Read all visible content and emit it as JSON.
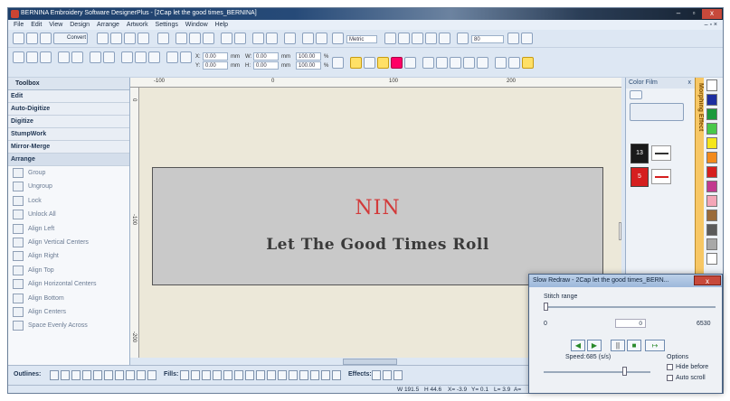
{
  "window": {
    "title": "BERNINA Embroidery Software DesignerPlus - [2Cap let the good times_BERNINA]"
  },
  "menu": [
    "File",
    "Edit",
    "View",
    "Design",
    "Arrange",
    "Artwork",
    "Settings",
    "Window",
    "Help"
  ],
  "toolbar": {
    "convert_label": "Convert",
    "metric_label": "Metric",
    "zoom_value": "80",
    "x_value": "0.00",
    "y_value": "0.00",
    "w_value": "0.00",
    "h_value": "0.00",
    "unit": "mm",
    "scale_w": "100.00",
    "scale_h": "100.00",
    "percent": "%"
  },
  "toolbox": {
    "title": "Toolbox",
    "sections": [
      "Edit",
      "Auto-Digitize",
      "Digitize",
      "StumpWork",
      "Mirror-Merge",
      "Arrange"
    ],
    "items": [
      "Group",
      "Ungroup",
      "Lock",
      "Unlock All",
      "Align Left",
      "Align Vertical Centers",
      "Align Right",
      "Align Top",
      "Align Horizontal Centers",
      "Align Bottom",
      "Align Centers",
      "Space Evenly Across"
    ]
  },
  "rulers": {
    "h": [
      "-100",
      "0",
      "100",
      "200"
    ],
    "v": [
      "0",
      "-100",
      "-200"
    ]
  },
  "design": {
    "logo": "NIN",
    "tagline": "Let The Good Times Roll"
  },
  "colorfilm": {
    "title": "Color Film",
    "items": [
      {
        "num": "13",
        "color": "#1a1a1a"
      },
      {
        "num": "5",
        "color": "#d51f1f"
      }
    ]
  },
  "morphing": {
    "label": "Morphing Effect"
  },
  "palette": [
    "#ffffff",
    "#1d2ea0",
    "#1a9a3c",
    "#48c84a",
    "#f5e61a",
    "#f28a1c",
    "#d61f1f",
    "#c23a8f",
    "#f4a6b8",
    "#9a6b3a",
    "#5b5b5b",
    "#a8a8a8",
    "#ffffff"
  ],
  "bottom": {
    "outlines_label": "Outlines:",
    "fills_label": "Fills:",
    "effects_label": "Effects:"
  },
  "status": {
    "w": "W 191.5",
    "h": "H 44.6",
    "x": "X= -3.9",
    "y": "Y= 0.1",
    "l": "L= 3.9",
    "a": "A="
  },
  "slow_redraw": {
    "title": "Slow Redraw - 2Cap let the good times_BERN...",
    "stitch_range": "Stitch range",
    "min": "0",
    "current": "0",
    "max": "6530",
    "speed_label": "Speed:",
    "speed_value": "685 (s/s)",
    "options_label": "Options",
    "hide_before": "Hide before",
    "auto_scroll": "Auto scroll"
  }
}
